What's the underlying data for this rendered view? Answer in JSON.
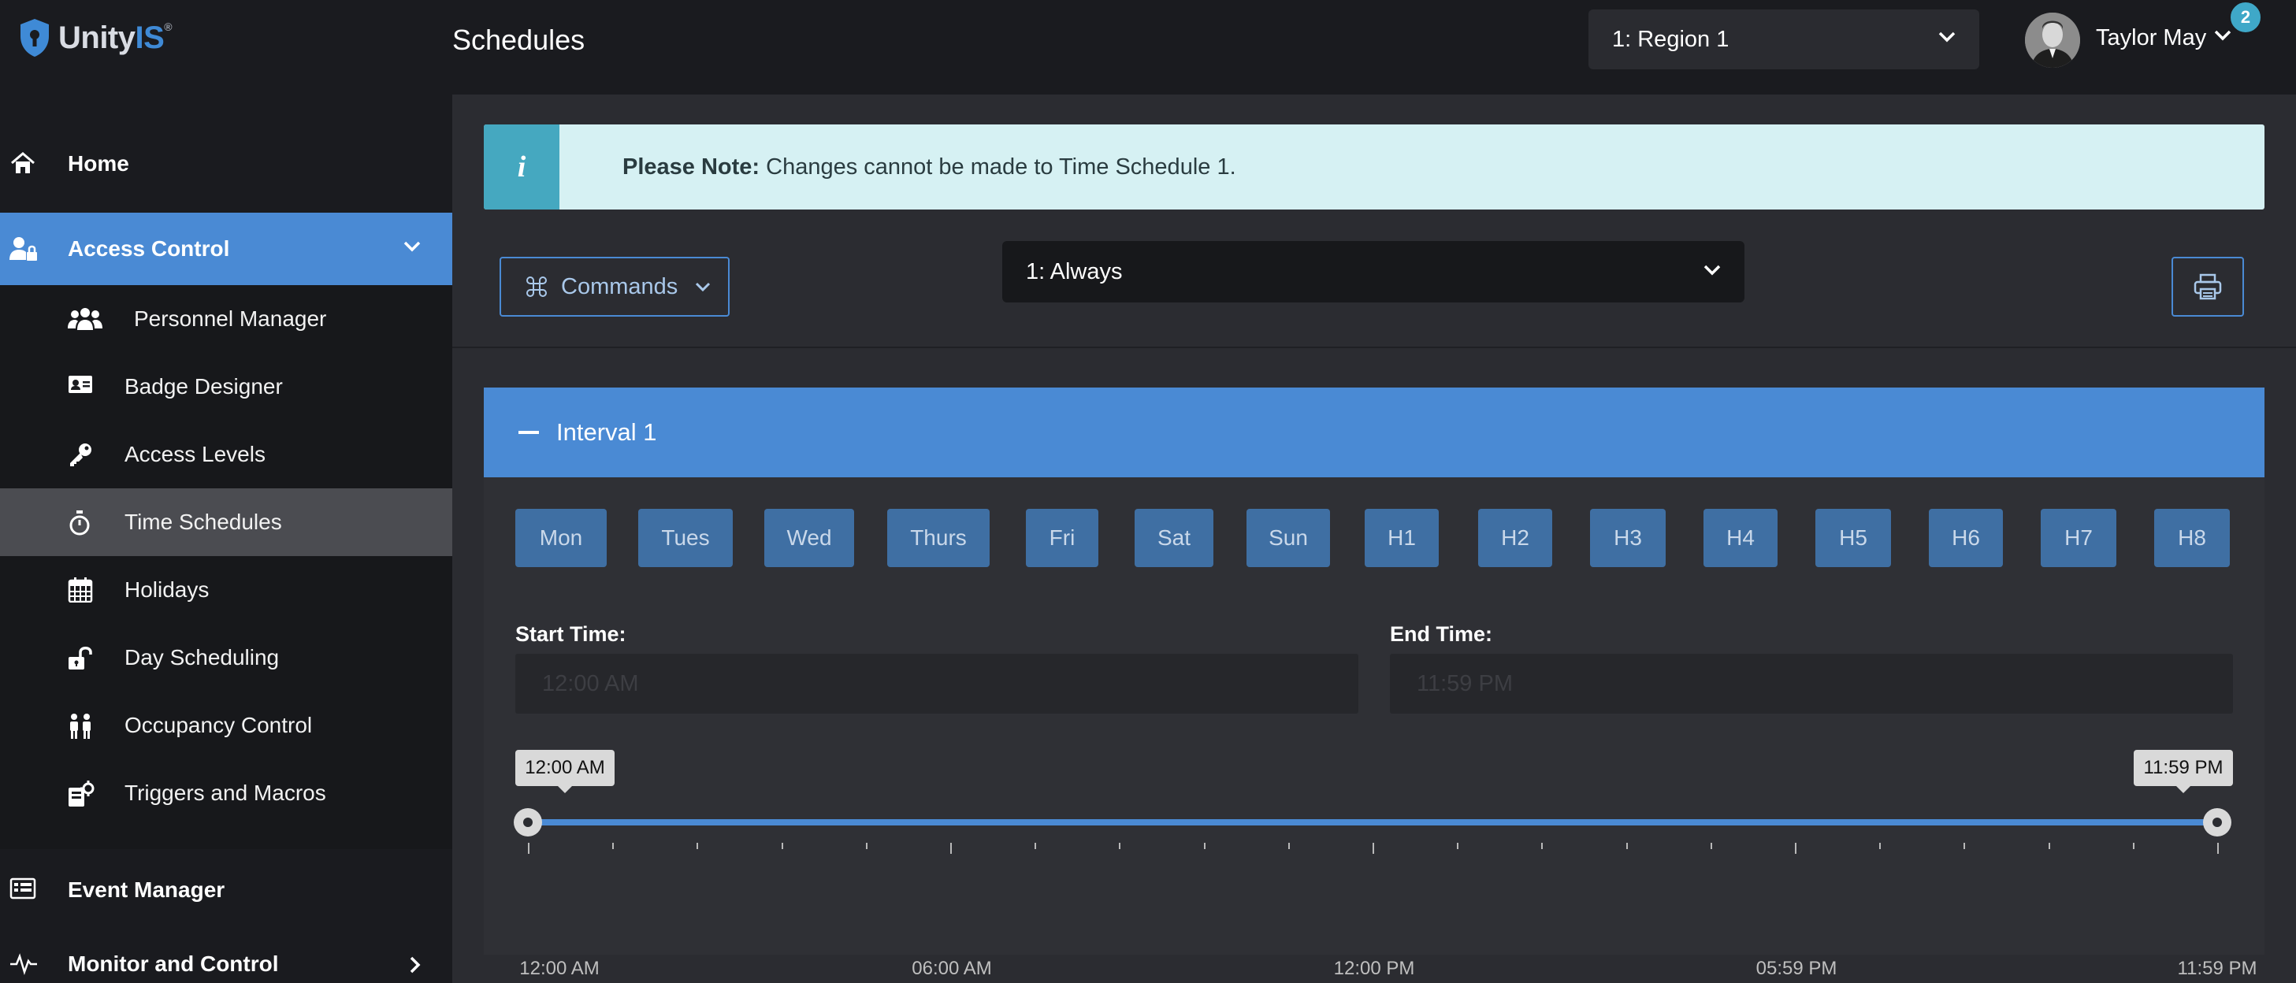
{
  "brand": {
    "name_main": "Unity",
    "name_accent": "IS",
    "trademark": "®"
  },
  "header": {
    "title": "Schedules",
    "region_select": "1: Region 1",
    "user_name": "Taylor May",
    "notification_count": "2"
  },
  "sidebar": {
    "home": "Home",
    "access_control": "Access Control",
    "sub_items": [
      {
        "label": "Personnel Manager",
        "icon": "users-icon"
      },
      {
        "label": "Badge Designer",
        "icon": "id-card-icon"
      },
      {
        "label": "Access Levels",
        "icon": "key-icon"
      },
      {
        "label": "Time Schedules",
        "icon": "stopwatch-icon"
      },
      {
        "label": "Holidays",
        "icon": "calendar-icon"
      },
      {
        "label": "Day Scheduling",
        "icon": "unlock-icon"
      },
      {
        "label": "Occupancy Control",
        "icon": "people-icon"
      },
      {
        "label": "Triggers and Macros",
        "icon": "trigger-icon"
      }
    ],
    "event_manager": "Event Manager",
    "monitor_control": "Monitor and Control"
  },
  "alert": {
    "bold": "Please Note:",
    "text": " Changes cannot be made to Time Schedule 1."
  },
  "toolbar": {
    "commands_label": "Commands",
    "schedule_select": "1: Always"
  },
  "interval": {
    "title": "Interval 1",
    "days": [
      "Mon",
      "Tues",
      "Wed",
      "Thurs",
      "Fri",
      "Sat",
      "Sun",
      "H1",
      "H2",
      "H3",
      "H4",
      "H5",
      "H6",
      "H7",
      "H8"
    ],
    "start_label": "Start Time:",
    "start_value": "12:00 AM",
    "end_label": "End Time:",
    "end_value": "11:59 PM",
    "slider": {
      "min_label": "12:00 AM",
      "max_label": "11:59 PM",
      "start_fraction": 0.0,
      "end_fraction": 1.0,
      "tick_labels": [
        "12:00 AM",
        "06:00 AM",
        "12:00 PM",
        "05:59 PM",
        "11:59 PM"
      ]
    }
  },
  "colors": {
    "accent": "#4a8ad4",
    "sidebar_bg": "#1a1b1f",
    "main_bg": "#2b2c31",
    "alert_bg": "#d6f1f3",
    "alert_icon_bg": "#45a8c0",
    "day_button": "#3f6fa3",
    "badge": "#3fa8c8"
  }
}
